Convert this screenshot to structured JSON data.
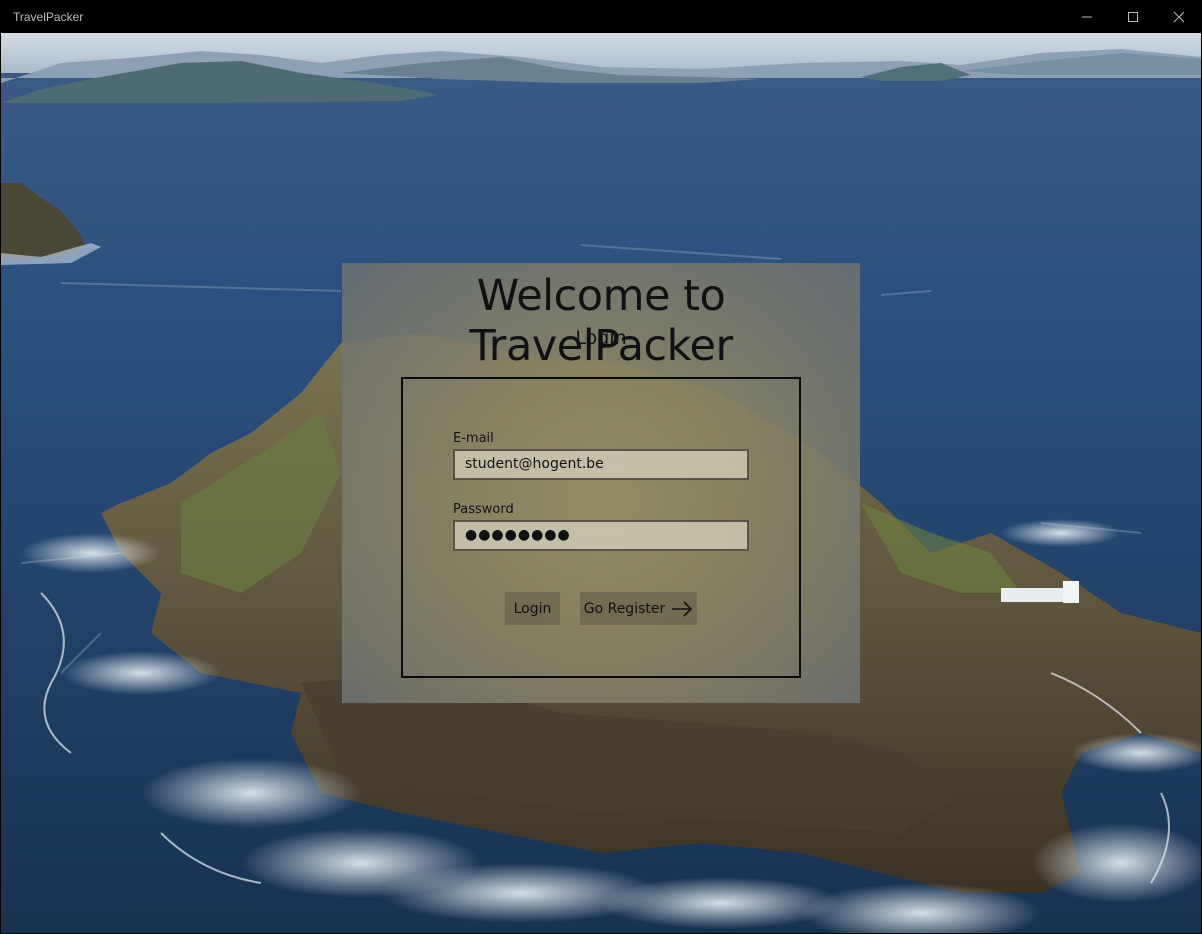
{
  "window": {
    "title": "TravelPacker",
    "controls": [
      "minimize-icon",
      "maximize-icon",
      "close-icon"
    ]
  },
  "login": {
    "heading": "Welcome to TravelPacker",
    "subtitle": "Login",
    "email_label": "E-mail",
    "email_value": "student@hogent.be",
    "password_label": "Password",
    "password_value": "●●●●●●●●",
    "login_button": "Login",
    "register_button": "Go Register",
    "register_icon": "arrow-right-icon"
  }
}
